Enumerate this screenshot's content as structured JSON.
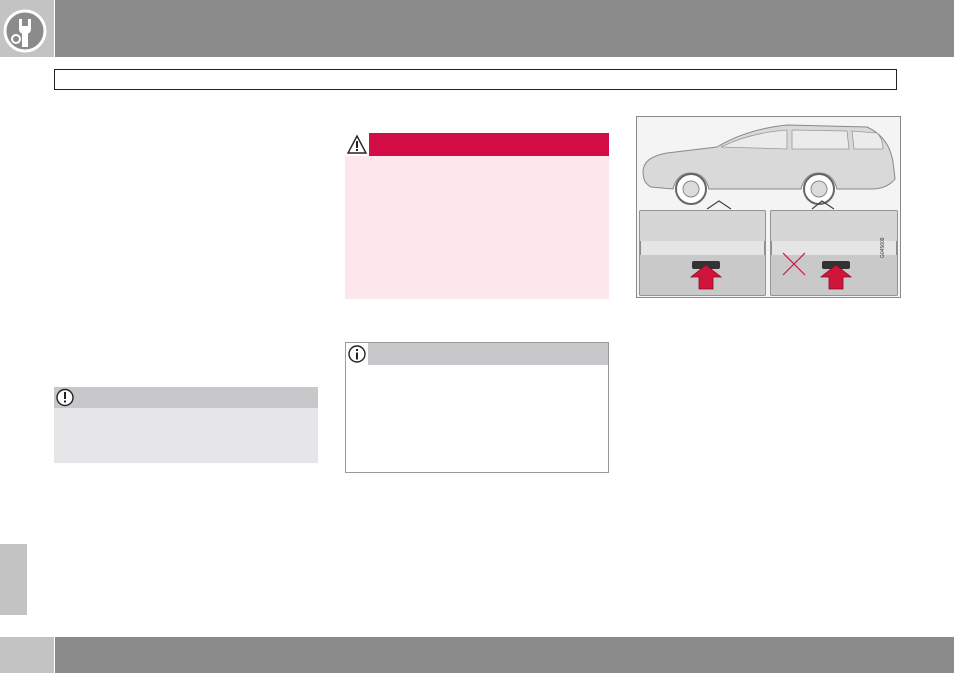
{
  "header": {
    "icon": "wrench-gear-icon",
    "section_title": ""
  },
  "sidebar": {
    "tab_label": ""
  },
  "important_box": {
    "icon": "exclamation-icon",
    "text": ""
  },
  "warning_box": {
    "icon": "warning-triangle-icon",
    "text": ""
  },
  "note_box": {
    "icon": "info-icon",
    "text": ""
  },
  "illustration": {
    "code": "G045609",
    "icons": [
      "car-side-illustration",
      "jack-point-correct-arrow",
      "jack-point-wrong-arrow",
      "cross-mark-icon"
    ]
  },
  "footer": {
    "page_number": ""
  },
  "colors": {
    "header_gray": "#8b8b8b",
    "tab_gray": "#c3c3c3",
    "warning_red": "#d20c45",
    "warning_bg": "#fbe7ec",
    "arrow_red": "#d0143c"
  }
}
